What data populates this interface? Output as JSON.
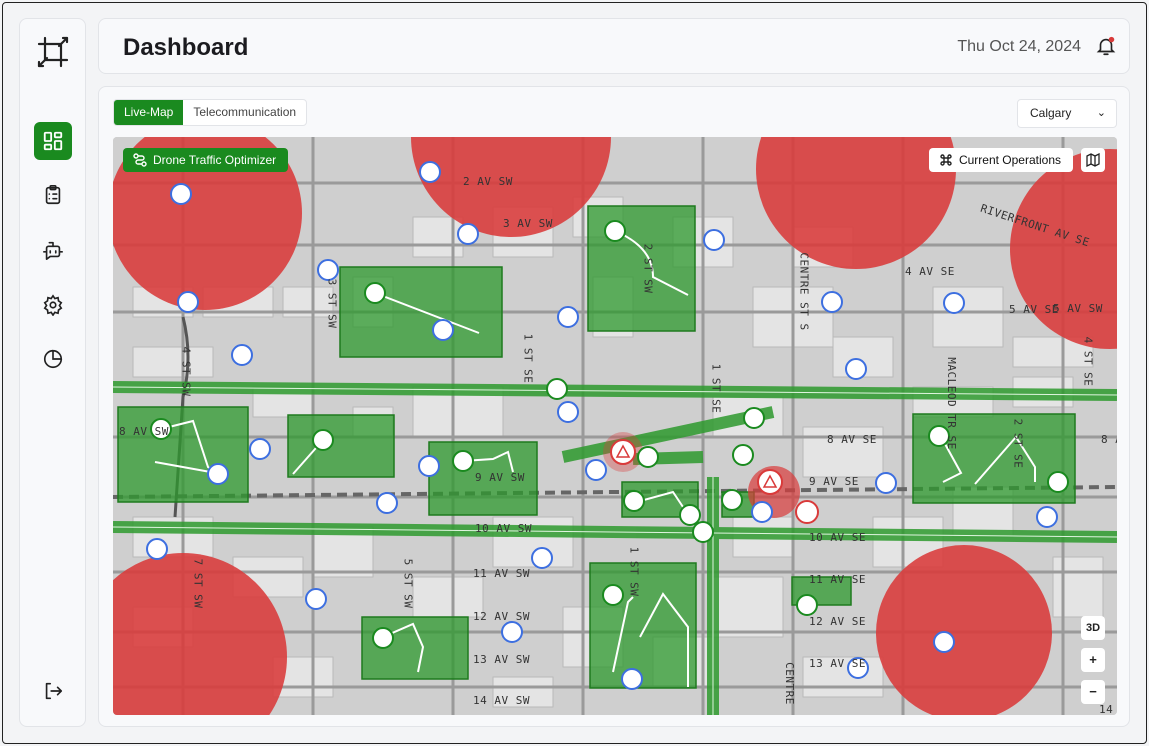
{
  "app": {
    "title": "Dashboard",
    "date": "Thu Oct 24, 2024",
    "accent_color": "#1a8a1f"
  },
  "sidebar": {
    "items": [
      {
        "icon": "dashboard-icon",
        "active": true
      },
      {
        "icon": "clipboard-icon",
        "active": false
      },
      {
        "icon": "bot-icon",
        "active": false
      },
      {
        "icon": "gear-icon",
        "active": false
      },
      {
        "icon": "pie-chart-icon",
        "active": false
      }
    ],
    "logout_icon": "logout-icon"
  },
  "tabs": [
    {
      "label": "Live-Map",
      "active": true
    },
    {
      "label": "Telecommunication",
      "active": false
    }
  ],
  "city_select": {
    "value": "Calgary"
  },
  "map": {
    "drone_optimizer_label": "Drone Traffic Optimizer",
    "current_ops_label": "Current Operations",
    "btn_3d": "3D",
    "btn_zoom_in": "+",
    "btn_zoom_out": "−",
    "no_fly_color": "#d93a3a",
    "zone_color": "#2e9a2e",
    "street_labels": [
      "2 AV SW",
      "3 AV SW",
      "RIVERFRONT AV SE",
      "4 AV SE",
      "5 AV SE",
      "4 ST SW",
      "3 ST SW",
      "2 ST SW",
      "MACLEOD TR SE",
      "CENTRE ST S",
      "8 AV SW",
      "8 AV SE",
      "9 AV SW",
      "9 AV SE",
      "10 AV SW",
      "10 AV SE",
      "11 AV SW",
      "11 AV SE",
      "12 AV SW",
      "12 AV SE",
      "13 AV SW",
      "13 AV SE",
      "14 AV SW",
      "7 ST SW",
      "5 ST SW",
      "1 ST SW",
      "1 ST SE",
      "CENTRE",
      "5 AV SW",
      "8 A",
      "14",
      "4 ST SE",
      "2 ST SE",
      "1 ST SE"
    ]
  }
}
